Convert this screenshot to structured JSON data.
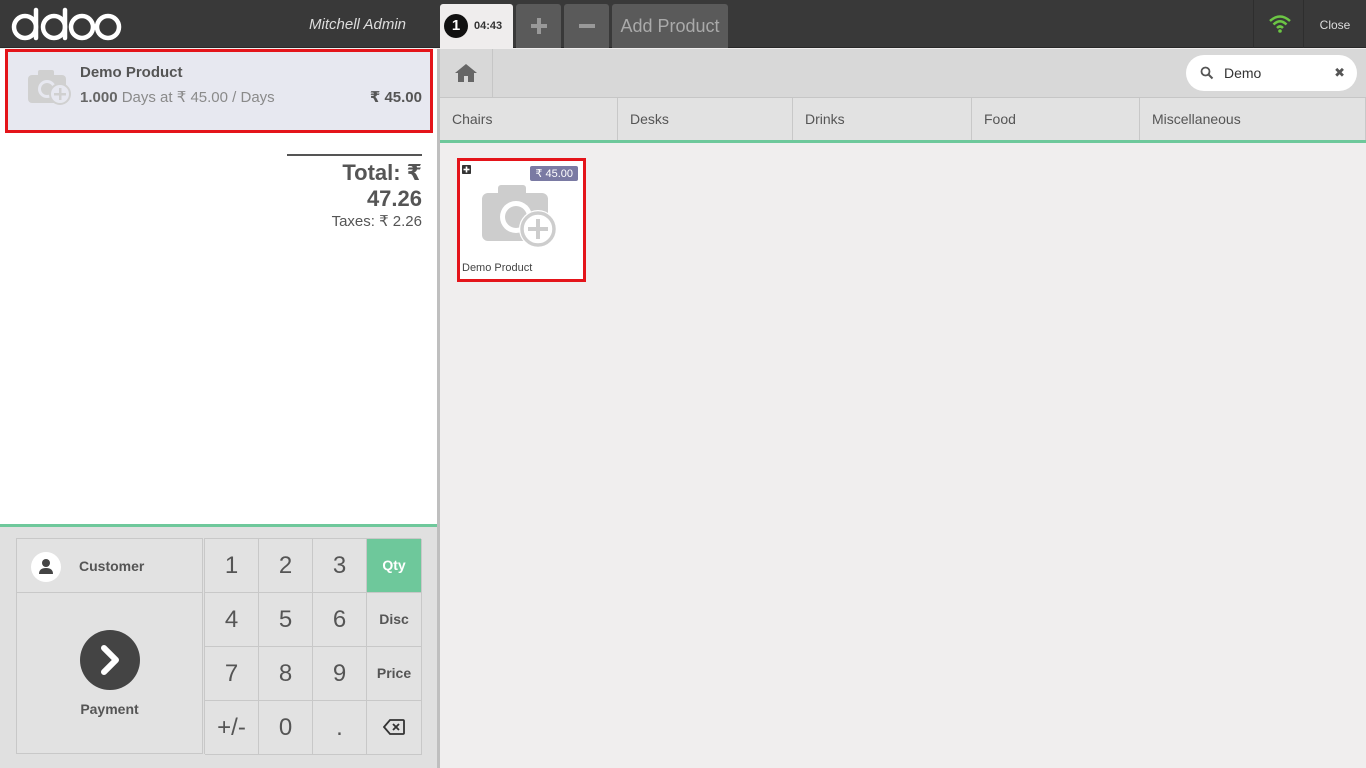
{
  "topbar": {
    "logo_text": "odoo",
    "cashier": "Mitchell Admin",
    "order_tab": {
      "number": "1",
      "time": "04:43"
    },
    "plus_icon": "plus-icon",
    "minus_icon": "minus-icon",
    "add_product_label": "Add Product",
    "wifi_icon": "wifi-icon",
    "close_label": "Close"
  },
  "orderline": {
    "name": "Demo Product",
    "qty": "1.000",
    "unit_info": "Days at ₹ 45.00 / Days",
    "price": "₹ 45.00"
  },
  "summary": {
    "total": "Total: ₹ 47.26",
    "taxes": "Taxes: ₹ 2.26"
  },
  "controls": {
    "customer_label": "Customer",
    "payment_label": "Payment",
    "numpad": {
      "k1": "1",
      "k2": "2",
      "k3": "3",
      "qty": "Qty",
      "k4": "4",
      "k5": "5",
      "k6": "6",
      "disc": "Disc",
      "k7": "7",
      "k8": "8",
      "k9": "9",
      "price": "Price",
      "plusminus": "+/-",
      "k0": "0",
      "dot": "."
    }
  },
  "products_screen": {
    "search_value": "Demo",
    "search_clear": "✖",
    "categories": [
      "Chairs",
      "Desks",
      "Drinks",
      "Food",
      "Miscellaneous"
    ],
    "product": {
      "name": "Demo Product",
      "price": "₹ 45.00"
    }
  },
  "colors": {
    "accent": "#6ec89b",
    "highlight": "#e4141a",
    "topbar": "#393939",
    "price_badge": "#7a7aa3"
  }
}
